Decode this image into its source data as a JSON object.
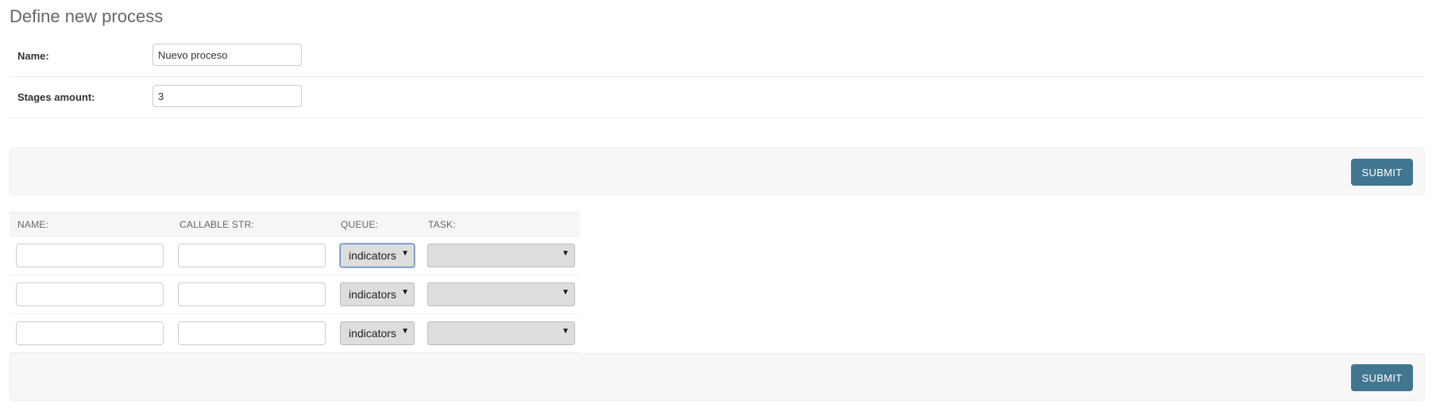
{
  "page": {
    "title": "Define new process"
  },
  "process_form": {
    "name_label": "Name:",
    "name_value": "Nuevo proceso",
    "stages_label": "Stages amount:",
    "stages_value": "3"
  },
  "submit_label": "SUBMIT",
  "stages_table": {
    "headers": {
      "name": "NAME:",
      "callable": "CALLABLE STR:",
      "queue": "QUEUE:",
      "task": "TASK:"
    },
    "rows": [
      {
        "name": "",
        "callable": "",
        "queue": "indicators",
        "task": ""
      },
      {
        "name": "",
        "callable": "",
        "queue": "indicators",
        "task": ""
      },
      {
        "name": "",
        "callable": "",
        "queue": "indicators",
        "task": ""
      }
    ]
  },
  "colors": {
    "submit_button": "#417690",
    "submit_row_bg": "#f8f8f8",
    "header_bg": "#f6f6f6"
  },
  "icons": {
    "select_caret": "caret-down-icon"
  }
}
